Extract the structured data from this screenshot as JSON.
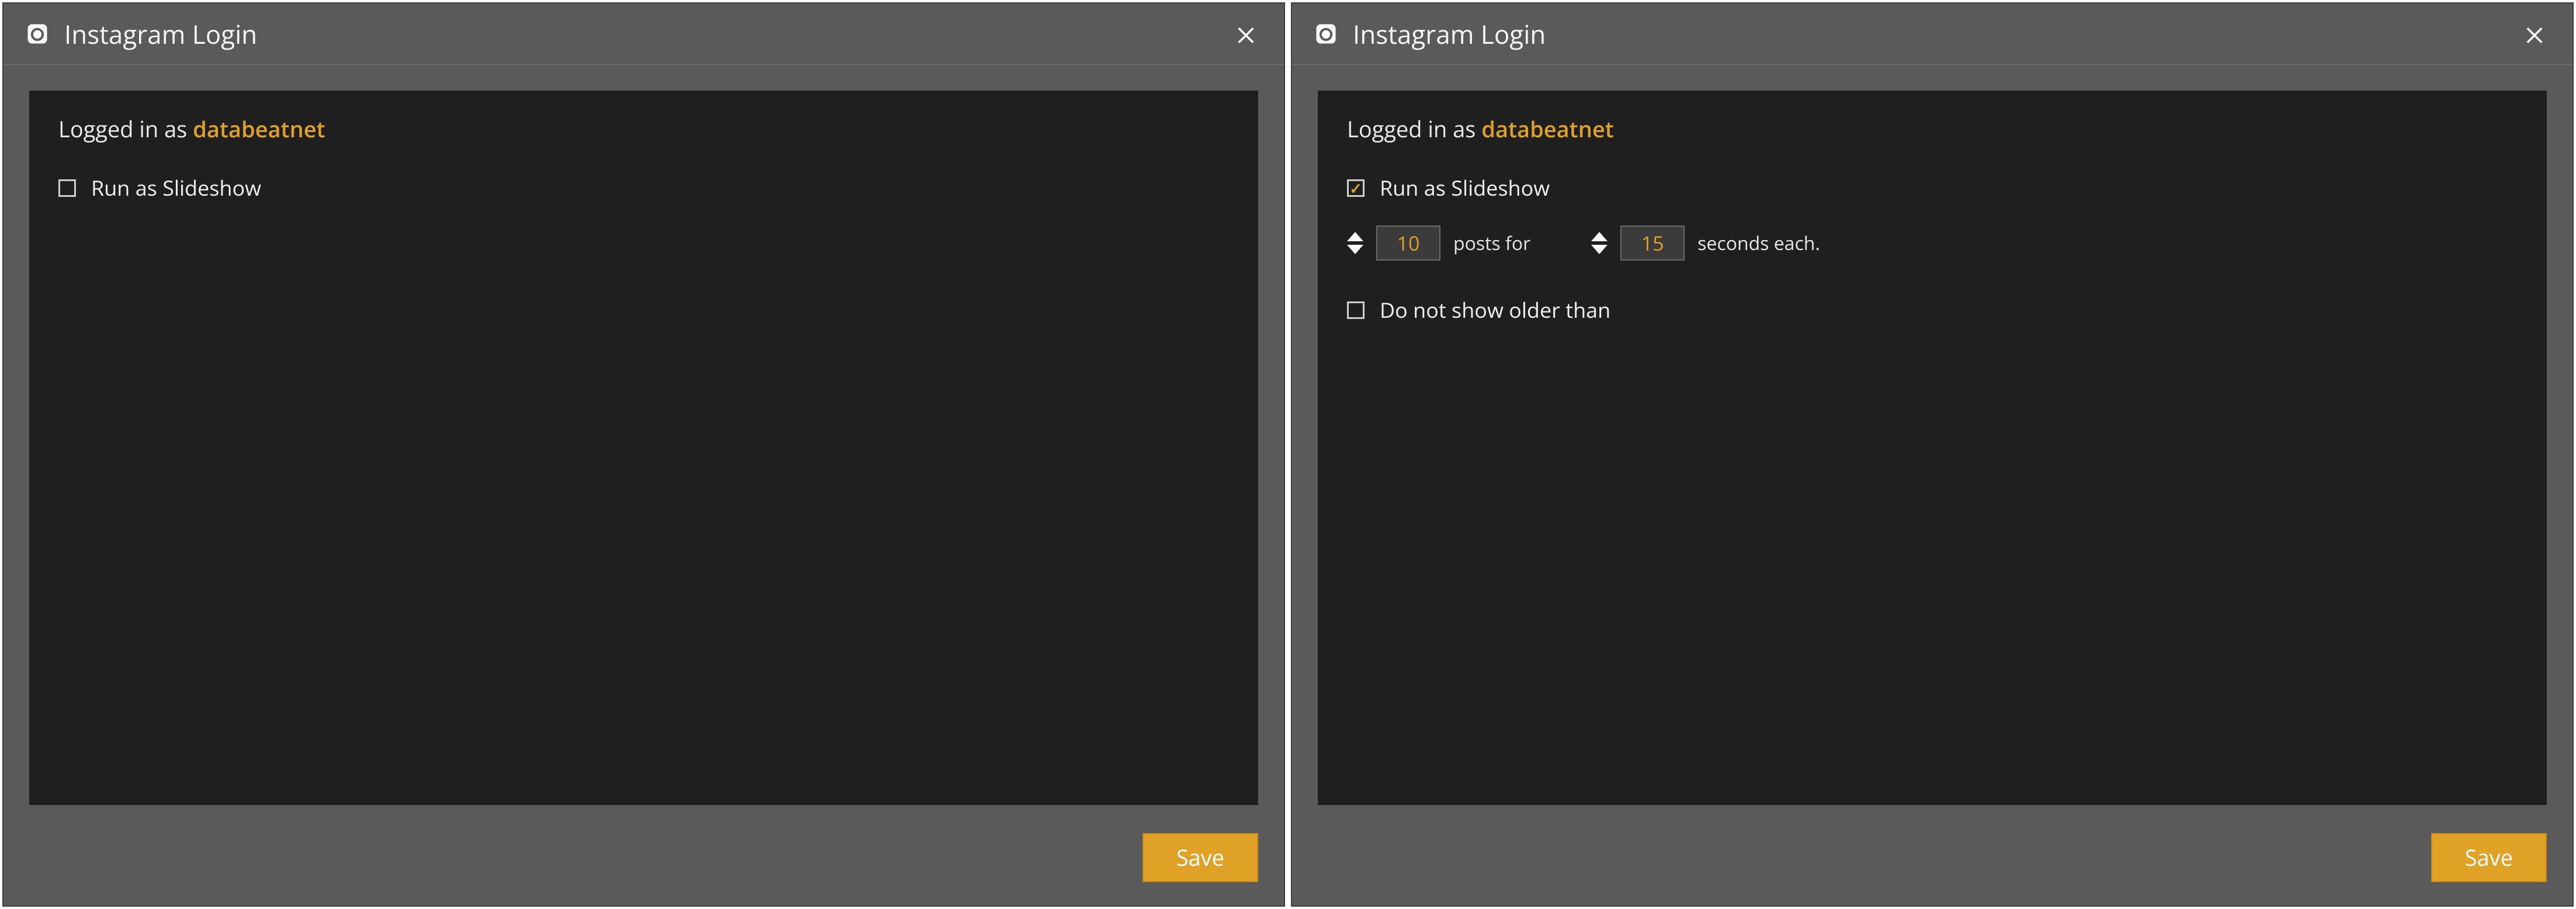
{
  "left": {
    "title": "Instagram Login",
    "logged_in_prefix": "Logged in as ",
    "username": "databeatnet",
    "run_slideshow_label": "Run as Slideshow",
    "run_slideshow_checked": false,
    "save_label": "Save"
  },
  "right": {
    "title": "Instagram Login",
    "logged_in_prefix": "Logged in as ",
    "username": "databeatnet",
    "run_slideshow_label": "Run as Slideshow",
    "run_slideshow_checked": true,
    "posts_value": "10",
    "posts_suffix": "posts for",
    "seconds_value": "15",
    "seconds_suffix": "seconds each.",
    "older_than_label": "Do not show older than",
    "older_than_checked": false,
    "save_label": "Save"
  },
  "colors": {
    "accent": "#e0a226",
    "panel_bg": "#1f1f1f",
    "window_bg": "#5a5a5a"
  }
}
